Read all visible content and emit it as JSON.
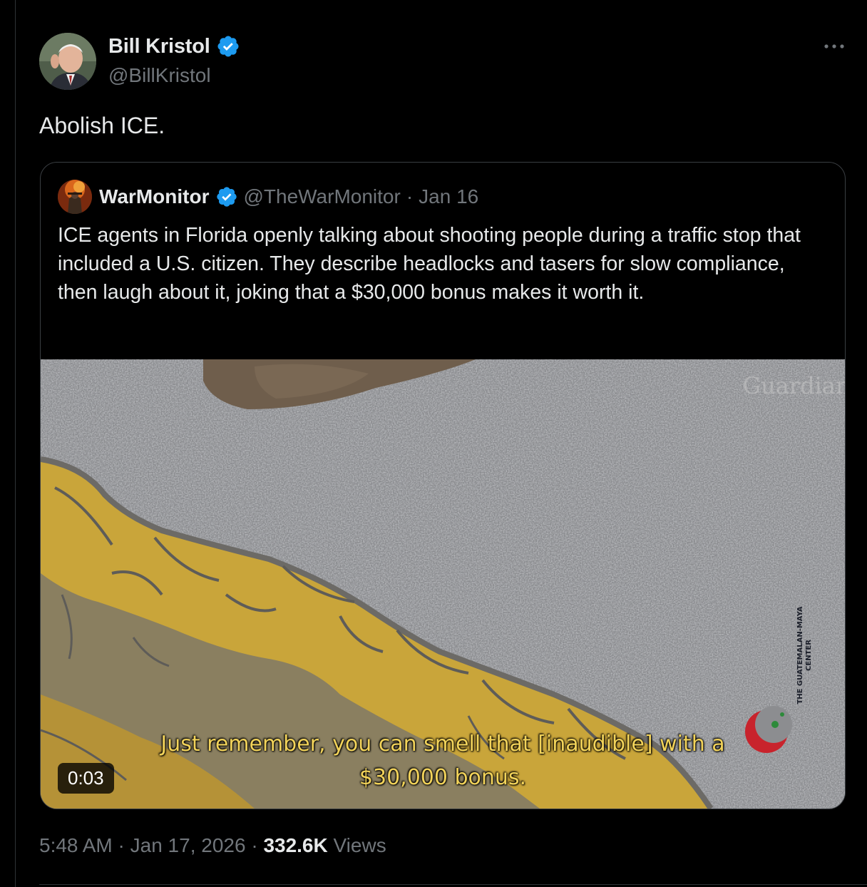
{
  "tweet": {
    "author_name": "Bill Kristol",
    "author_handle": "@BillKristol",
    "text": "Abolish ICE.",
    "time": "5:48 AM",
    "date": "Jan 17, 2026",
    "separator": "·",
    "views_count": "332.6K",
    "views_label": "Views",
    "verified_icon": "verified-badge-icon",
    "more_icon": "more-dots-icon"
  },
  "quote": {
    "author_name": "WarMonitor",
    "author_handle": "@TheWarMonitor",
    "separator": "·",
    "date": "Jan 16",
    "text": "ICE agents in Florida openly talking about shooting people during a traffic stop that included a U.S. citizen. They describe headlocks and tasers for slow compliance, then laugh about it, joking that a $30,000 bonus makes it worth it.",
    "video": {
      "timestamp": "0:03",
      "subtitle_line1": "Just remember, you can smell that [inaudible] with a",
      "subtitle_line2": "$30,000 bonus.",
      "watermark_vertical": "THE GUATEMALAN-MAYA CENTER"
    }
  },
  "colors": {
    "background": "#000000",
    "text_primary": "#e7e9ea",
    "text_secondary": "#71767b",
    "verified_blue": "#1d9bf0",
    "border": "#2f3336",
    "subtitle_yellow": "#f2d35a"
  }
}
